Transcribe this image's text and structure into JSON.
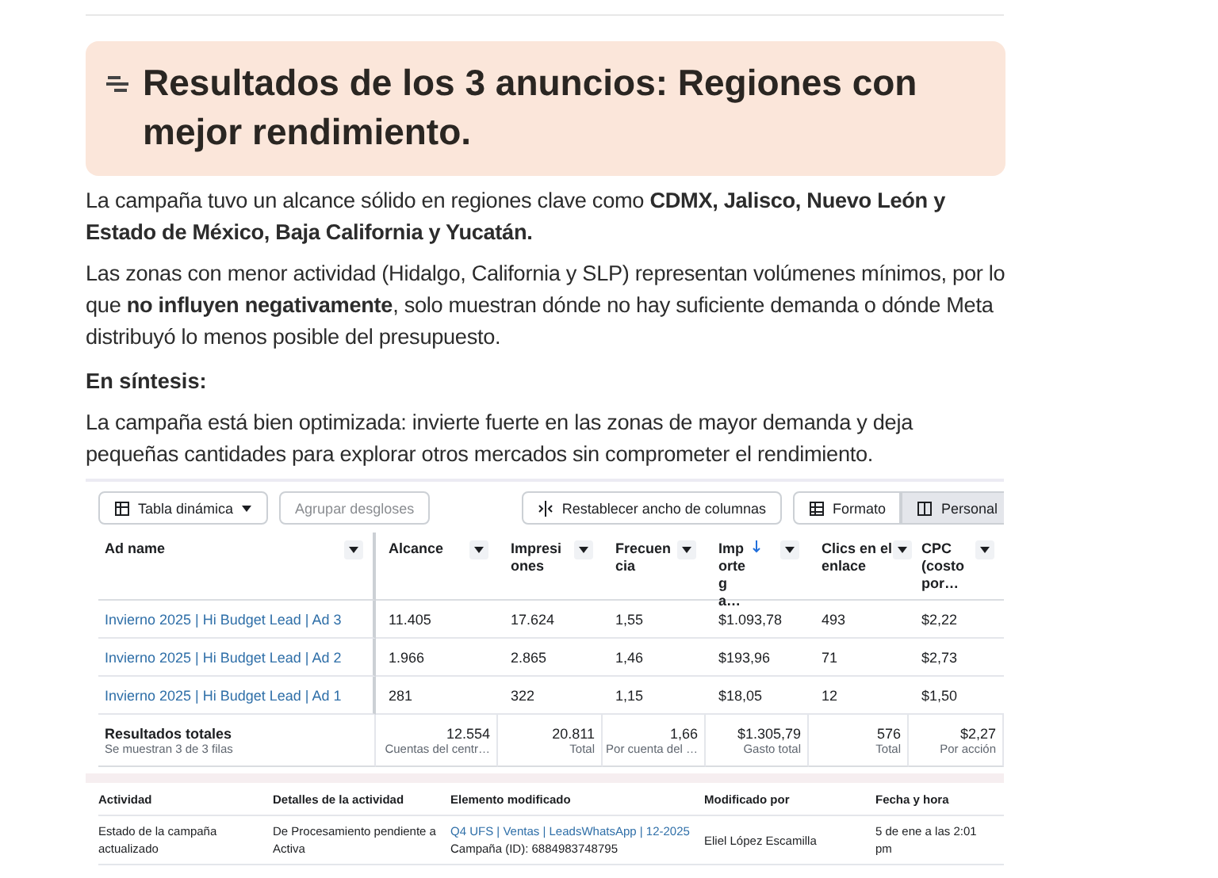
{
  "callout": {
    "title": "Resultados de los 3 anuncios: Regiones con mejor rendimiento."
  },
  "paragraphs": [
    "La campaña tuvo un alcance sólido en regiones clave como **CDMX, Jalisco, Nuevo León y Estado de México, Baja California y Yucatán.**",
    "Las zonas con menor actividad (Hidalgo, California y SLP) representan volúmenes mínimos, por lo que **no influyen negativamente**, solo muestran dónde no hay suficiente demanda o dónde Meta distribuyó lo menos posible del presupuesto."
  ],
  "subheading": "En síntesis:",
  "conclusion": "La campaña está bien optimizada: invierte fuerte en las zonas de mayor demanda y deja pequeñas cantidades para explorar otros mercados sin comprometer el rendimiento.",
  "ads_table": {
    "toolbar": {
      "pivot": "Tabla dinámica",
      "group": "Agrupar desgloses",
      "reset": "Restablecer ancho de columnas",
      "views": [
        {
          "label": "Formato",
          "selected": false
        },
        {
          "label": "Personal",
          "selected": true
        }
      ]
    },
    "columns": [
      {
        "label": "Ad name"
      },
      {
        "label": "Alcance"
      },
      {
        "label": "Impresiones"
      },
      {
        "label": "Frecuencia"
      },
      {
        "label": "Importe ga…",
        "sorted": true
      },
      {
        "label": "Clics en el enlace"
      },
      {
        "label": "CPC (costo por…"
      }
    ],
    "rows": [
      [
        "Invierno 2025 | Hi Budget Lead | Ad 3",
        "11.405",
        "17.624",
        "1,55",
        "$1.093,78",
        "493",
        "$2,22"
      ],
      [
        "Invierno 2025 | Hi Budget Lead | Ad 2",
        "1.966",
        "2.865",
        "1,46",
        "$193,96",
        "71",
        "$2,73"
      ],
      [
        "Invierno 2025 | Hi Budget Lead | Ad 1",
        "281",
        "322",
        "1,15",
        "$18,05",
        "12",
        "$1,50"
      ]
    ],
    "totals": {
      "title": "Resultados totales",
      "note": "Se muestran 3 de 3 filas",
      "cells": [
        {
          "value": "12.554",
          "caption": "Cuentas del centr…"
        },
        {
          "value": "20.811",
          "caption": "Total"
        },
        {
          "value": "1,66",
          "caption": "Por cuenta del …"
        },
        {
          "value": "$1.305,79",
          "caption": "Gasto total"
        },
        {
          "value": "576",
          "caption": "Total"
        },
        {
          "value": "$2,27",
          "caption": "Por acción"
        }
      ]
    }
  },
  "activity_table": {
    "columns": [
      "Actividad",
      "Detalles de la actividad",
      "Elemento modificado",
      "Modificado por",
      "Fecha y hora"
    ],
    "rows": [
      {
        "activity": "Estado de la campaña actualizado",
        "details": "De Procesamiento pendiente a Activa",
        "item_link": "Q4 UFS | Ventas | LeadsWhatsApp | 12-2025",
        "item_id": "Campaña (ID): 6884983748795",
        "by": "Eliel López Escamilla",
        "date": "5 de ene a las 2:01 pm"
      }
    ]
  }
}
